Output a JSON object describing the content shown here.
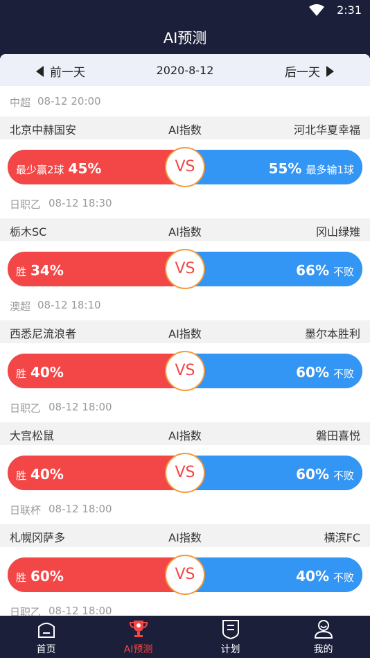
{
  "status_bar": {
    "time": "2:31"
  },
  "header": {
    "title": "AI预测"
  },
  "date_nav": {
    "prev_label": "前一天",
    "date": "2020-8-12",
    "next_label": "后一天"
  },
  "matches": [
    {
      "league": "中超",
      "time": "08-12 20:00",
      "home": "北京中赫国安",
      "center": "AI指数",
      "away": "河北华夏幸福",
      "home_label": "最少赢2球",
      "home_pct": "45%",
      "away_pct": "55%",
      "away_label": "最多输1球",
      "vs": "VS",
      "home_share": 0.45
    },
    {
      "league": "日职乙",
      "time": "08-12 18:30",
      "home": "栃木SC",
      "center": "AI指数",
      "away": "冈山绿雉",
      "home_label": "胜",
      "home_pct": "34%",
      "away_pct": "66%",
      "away_label": "不败",
      "vs": "VS",
      "home_share": 0.34
    },
    {
      "league": "澳超",
      "time": "08-12 18:10",
      "home": "西悉尼流浪者",
      "center": "AI指数",
      "away": "墨尔本胜利",
      "home_label": "胜",
      "home_pct": "40%",
      "away_pct": "60%",
      "away_label": "不败",
      "vs": "VS",
      "home_share": 0.4
    },
    {
      "league": "日职乙",
      "time": "08-12 18:00",
      "home": "大宫松鼠",
      "center": "AI指数",
      "away": "磐田喜悦",
      "home_label": "胜",
      "home_pct": "40%",
      "away_pct": "60%",
      "away_label": "不败",
      "vs": "VS",
      "home_share": 0.4
    },
    {
      "league": "日联杯",
      "time": "08-12 18:00",
      "home": "札幌冈萨多",
      "center": "AI指数",
      "away": "横滨FC",
      "home_label": "胜",
      "home_pct": "60%",
      "away_pct": "40%",
      "away_label": "不败",
      "vs": "VS",
      "home_share": 0.6
    }
  ],
  "partial_match": {
    "league": "日职乙",
    "time": "08-12 18:00"
  },
  "tabs": [
    {
      "label": "首页",
      "icon": "home-icon"
    },
    {
      "label": "AI预测",
      "icon": "trophy-icon"
    },
    {
      "label": "计划",
      "icon": "shield-doc-icon"
    },
    {
      "label": "我的",
      "icon": "user-icon"
    }
  ],
  "colors": {
    "dark": "#1b1f3a",
    "home_red": "#f34646",
    "away_blue": "#3395f4",
    "vs_border": "#f39a3b"
  }
}
